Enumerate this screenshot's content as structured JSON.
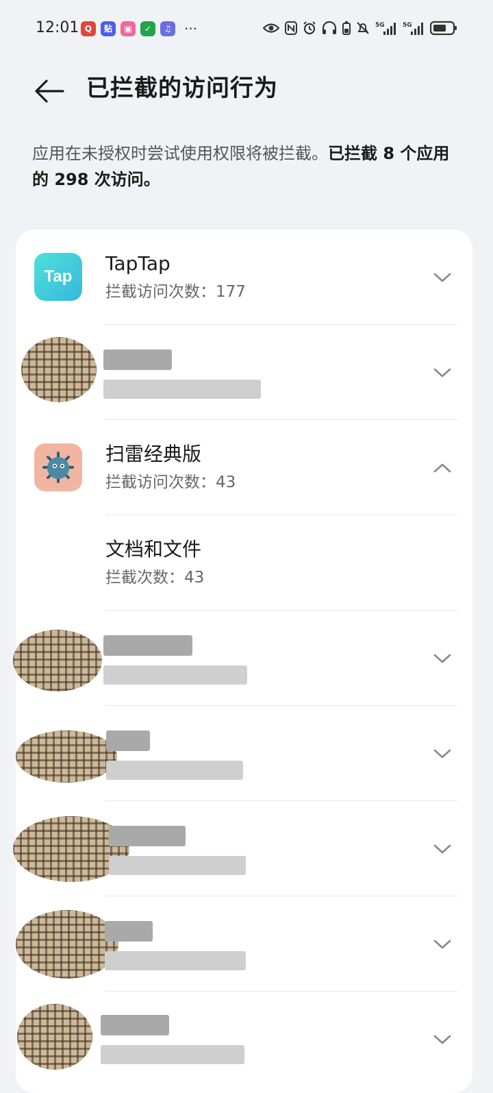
{
  "status_bar": {
    "time": "12:01",
    "more": "···",
    "notification_apps": [
      {
        "name": "search-app-icon",
        "color": "#e1463b",
        "glyph": "Q"
      },
      {
        "name": "tieba-app-icon",
        "color": "#4b5cf0",
        "glyph": "贴"
      },
      {
        "name": "bilibili-app-icon",
        "color": "#f0679a",
        "glyph": "▣"
      },
      {
        "name": "shield-app-icon",
        "color": "#22a54a",
        "glyph": "✓"
      },
      {
        "name": "music-app-icon",
        "color": "#6a6fe0",
        "glyph": "♫"
      }
    ],
    "network_label": "5G"
  },
  "header": {
    "title": "已拦截的访问行为"
  },
  "summary": {
    "prefix": "应用在未授权时尝试使用权限将被拦截。",
    "bold": "已拦截 8 个应用的 298 次访问。"
  },
  "list": [
    {
      "title": "TapTap",
      "sub": "拦截访问次数：177",
      "expanded": false,
      "icon": "taptap"
    },
    {
      "title": "",
      "sub": "",
      "expanded": false,
      "icon": "redacted"
    },
    {
      "title": "扫雷经典版",
      "sub": "拦截访问次数：43",
      "expanded": true,
      "icon": "minesweeper"
    },
    {
      "title": "文档和文件",
      "sub": "拦截次数：43",
      "child": true
    },
    {
      "title": "",
      "sub": "",
      "expanded": false,
      "icon": "redacted"
    },
    {
      "title": "",
      "sub": "",
      "expanded": false,
      "icon": "redacted"
    },
    {
      "title": "",
      "sub": "",
      "expanded": false,
      "icon": "redacted"
    },
    {
      "title": "",
      "sub": "",
      "expanded": false,
      "icon": "redacted"
    },
    {
      "title": "",
      "sub": "",
      "expanded": false,
      "icon": "redacted"
    }
  ],
  "taptap_icon_text": "Tap",
  "colors": {
    "background": "#f1f2f6",
    "card": "#ffffff",
    "taptap": "#3ecfd8",
    "minesweeper_bg": "#f2b5a1"
  }
}
